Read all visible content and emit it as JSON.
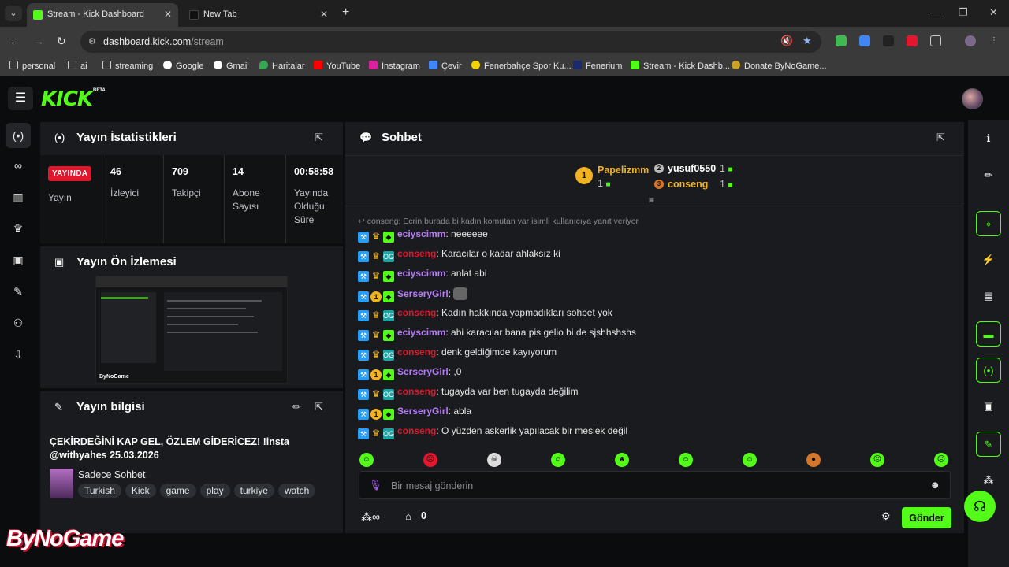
{
  "browser": {
    "tabs": [
      {
        "title": "Stream - Kick Dashboard",
        "active": true
      },
      {
        "title": "New Tab",
        "active": false
      }
    ],
    "url_host": "dashboard.kick.com",
    "url_path": "/stream",
    "bookmarks": [
      "personal",
      "ai",
      "streaming",
      "Google",
      "Gmail",
      "Haritalar",
      "YouTube",
      "Instagram",
      "Çevir",
      "Fenerbahçe Spor Ku...",
      "Fenerium",
      "Stream - Kick Dashb...",
      "Donate ByNoGame..."
    ]
  },
  "header": {
    "logo": "KICK",
    "beta": "BETA"
  },
  "stats": {
    "title": "Yayın İstatistikleri",
    "live_badge": "YAYINDA",
    "live_label": "Yayın",
    "viewers": {
      "value": "46",
      "label": "İzleyici"
    },
    "followers": {
      "value": "709",
      "label": "Takipçi"
    },
    "subs": {
      "value": "14",
      "label": "Abone Sayısı"
    },
    "uptime": {
      "value": "00:58:58",
      "label": "Yayında Olduğu Süre"
    }
  },
  "preview": {
    "title": "Yayın Ön İzlemesi",
    "brand": "ByNoGame"
  },
  "info": {
    "title": "Yayın bilgisi",
    "stream_title": "ÇEKİRDEĞİNİ KAP GEL, ÖZLEM GİDERİCEZ! !insta @withyahes 25.03.2026",
    "category": "Sadece Sohbet",
    "tags": [
      "Turkish",
      "Kick",
      "game",
      "play",
      "turkiye",
      "watch"
    ]
  },
  "chat": {
    "title": "Sohbet",
    "leaders": [
      {
        "rank": "1",
        "name": "Papelizmm",
        "count": "1"
      },
      {
        "rank": "2",
        "name": "yusuf0550",
        "count": "1"
      },
      {
        "rank": "3",
        "name": "conseng",
        "count": "1"
      }
    ],
    "reply_context": "conseng: Ecrin burada bi kadın komutan var isimli kullanıcıya yanıt veriyor",
    "messages": [
      {
        "user": "eciyscimm",
        "text": ": neeeeee",
        "color": "#b77cf7",
        "badge": "sub"
      },
      {
        "user": "conseng",
        "text": ": Karacılar o kadar ahlaksız ki",
        "color": "#e2162c",
        "badge": "og"
      },
      {
        "user": "eciyscimm",
        "text": ": anlat abi",
        "color": "#b77cf7",
        "badge": "sub"
      },
      {
        "user": "SerseryGirl",
        "text": ":",
        "color": "#b77cf7",
        "badge": "one"
      },
      {
        "user": "conseng",
        "text": ": Kadın hakkında yapmadıkları sohbet yok",
        "color": "#e2162c",
        "badge": "og"
      },
      {
        "user": "eciyscimm",
        "text": ": abi karacılar bana pis gelio bi de sjshhshshs",
        "color": "#b77cf7",
        "badge": "sub"
      },
      {
        "user": "conseng",
        "text": ": denk geldiğimde kayıyorum",
        "color": "#e2162c",
        "badge": "og"
      },
      {
        "user": "SerseryGirl",
        "text": ": ,0",
        "color": "#b77cf7",
        "badge": "one"
      },
      {
        "user": "conseng",
        "text": ": tugayda var ben tugayda değilim",
        "color": "#e2162c",
        "badge": "og"
      },
      {
        "user": "SerseryGirl",
        "text": ": abla",
        "color": "#b77cf7",
        "badge": "one"
      },
      {
        "user": "conseng",
        "text": ": O yüzden askerlik yapılacak bir meslek değil",
        "color": "#e2162c",
        "badge": "og"
      }
    ],
    "input_placeholder": "Bir mesaj gönderin",
    "points": "0",
    "send_label": "Gönder"
  },
  "watermark": "ByNoGame",
  "colors": {
    "accent": "#53fc18",
    "live": "#e2162c",
    "username_purple": "#b77cf7",
    "username_red": "#e2162c"
  }
}
